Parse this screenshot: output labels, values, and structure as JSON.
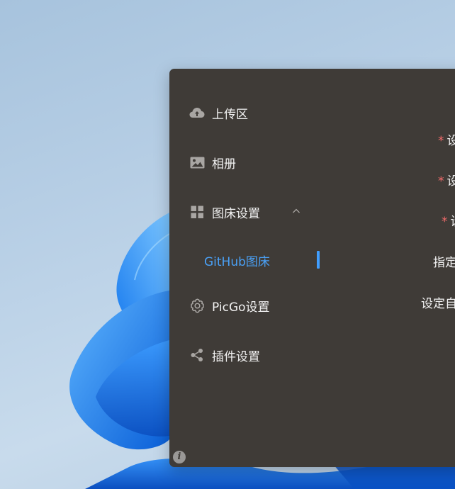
{
  "sidebar": {
    "items": [
      {
        "label": "上传区",
        "icon": "cloud-upload-icon"
      },
      {
        "label": "相册",
        "icon": "picture-icon"
      },
      {
        "label": "图床设置",
        "icon": "grid-icon",
        "expanded": true
      },
      {
        "label": "PicGo设置",
        "icon": "gear-icon"
      },
      {
        "label": "插件设置",
        "icon": "share-icon"
      }
    ],
    "submenu": {
      "label": "GitHub图床",
      "active": true
    },
    "info_icon": "i"
  },
  "form": {
    "required_mark": "*",
    "labels": [
      "设",
      "设",
      "设",
      "指定",
      "设定自"
    ]
  },
  "colors": {
    "window_bg": "#3f3b37",
    "accent": "#409eff",
    "required": "#f56c6c"
  }
}
